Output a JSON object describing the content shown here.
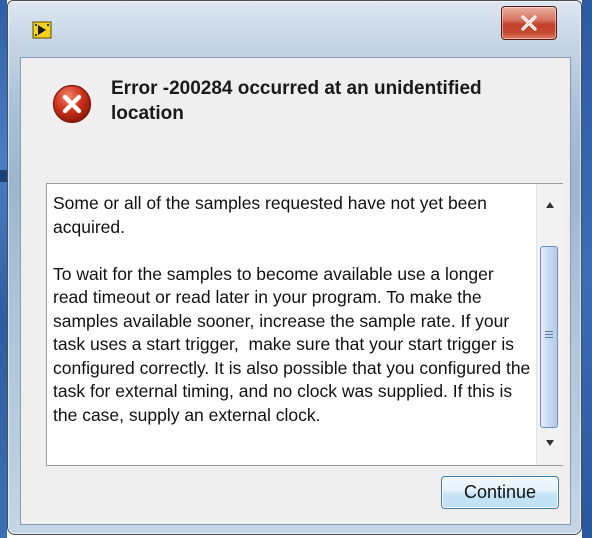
{
  "window": {
    "close_glyph": "x",
    "icons": [
      "labview-vi-icon",
      "close-icon",
      "error-icon"
    ],
    "colors": {
      "close_button": "#c7452f",
      "error_red": "#d0321c",
      "frame_blue": "#2e5fa6"
    }
  },
  "dialog": {
    "title": "Error -200284 occurred at an unidentified location",
    "message": "Some or all of the samples requested have not yet been acquired.\n\nTo wait for the samples to become available use a longer read timeout or read later in your program. To make the samples available sooner, increase the sample rate. If your task uses a start trigger,  make sure that your start trigger is configured correctly. It is also possible that you configured the task for external timing, and no clock was supplied. If this is the case, supply an external clock.",
    "continue_label": "Continue"
  }
}
